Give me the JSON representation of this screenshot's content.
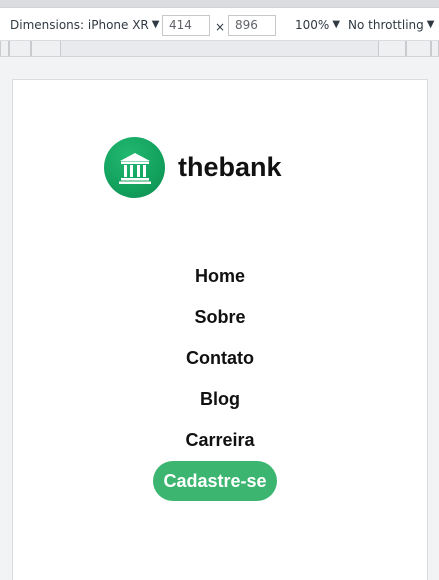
{
  "devtools": {
    "dimensions_label": "Dimensions: iPhone XR",
    "width_value": "414",
    "times": "×",
    "height_value": "896",
    "zoom": "100%",
    "throttling": "No throttling"
  },
  "site": {
    "brand": "thebank",
    "nav": [
      "Home",
      "Sobre",
      "Contato",
      "Blog",
      "Carreira"
    ],
    "cta": "Cadastre-se",
    "colors": {
      "accent": "#3bb56f",
      "logo": "#14a35f"
    },
    "logo_icon": "bank-icon"
  }
}
